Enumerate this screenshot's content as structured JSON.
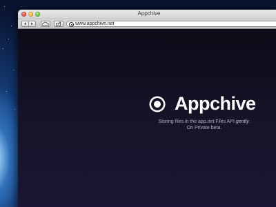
{
  "window": {
    "title": "Appchive",
    "controls": [
      "close",
      "minimize",
      "zoom"
    ]
  },
  "toolbar": {
    "buttons": [
      "back-icon",
      "forward-icon",
      "icloud-tabs-icon",
      "share-icon"
    ],
    "address": {
      "url": "www.appchive.net",
      "site_icon": "appchive-logo-icon"
    }
  },
  "page": {
    "brand": "Appchive",
    "logo_icon": "appchive-logo-icon",
    "tagline_before": "Storing files in the app.net Files API ",
    "tagline_emphasis": "gently",
    "tagline_after": ".",
    "status": "On Private beta."
  },
  "colors": {
    "page_background": "#17132a",
    "brand_text": "#ffffff",
    "tagline_text": "#b3b0c0"
  }
}
